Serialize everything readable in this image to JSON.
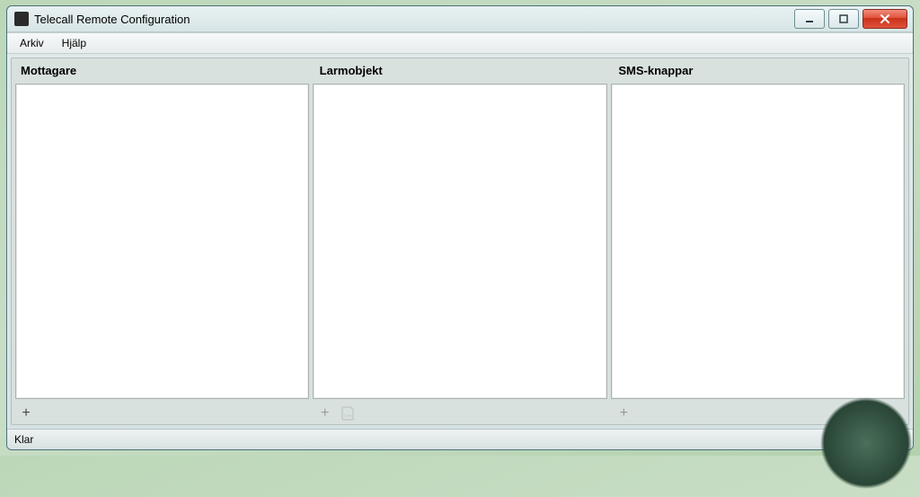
{
  "window": {
    "title": "Telecall Remote Configuration"
  },
  "menu": {
    "arkiv": "Arkiv",
    "hjalp": "Hjälp"
  },
  "columns": {
    "mottagare": "Mottagare",
    "larmobjekt": "Larmobjekt",
    "sms_knappar": "SMS-knappar"
  },
  "toolbar": {
    "add_mottagare": "+",
    "add_larmobjekt": "+",
    "add_sms": "+"
  },
  "status": {
    "text": "Klar"
  }
}
